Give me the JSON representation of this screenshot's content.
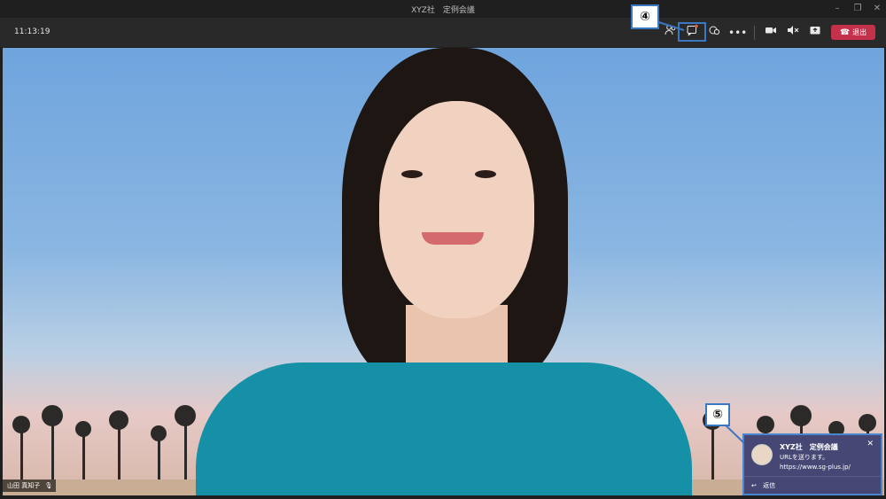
{
  "window": {
    "title": "XYZ社　定例会議"
  },
  "toolbar": {
    "clock": "11:13:19",
    "leave_label": "退出",
    "icons": [
      "participants-icon",
      "chat-icon",
      "reactions-icon",
      "more-icon",
      "camera-icon",
      "mute-icon",
      "share-icon",
      "phone-icon"
    ]
  },
  "callouts": {
    "step4": "④",
    "step5": "⑤"
  },
  "video": {
    "participant_name": "山田 真知子"
  },
  "chat_notification": {
    "title": "XYZ社　定例会議",
    "message": "URLを送ります。 https://www.sg-plus.jp/",
    "reply_label": "返信"
  },
  "colors": {
    "leave": "#c4314b",
    "chat_card": "#464775",
    "callout_border": "#3a78c2"
  }
}
